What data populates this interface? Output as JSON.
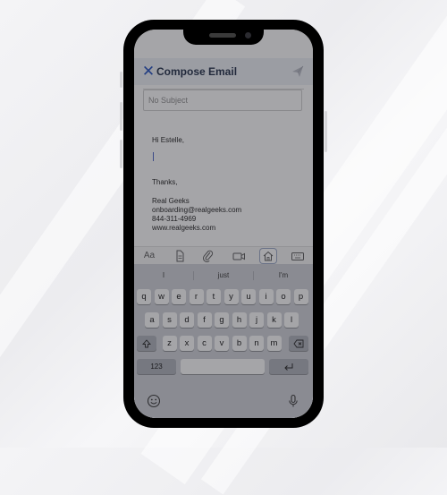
{
  "header": {
    "title": "Compose Email",
    "close_icon": "close-icon",
    "send_icon": "paper-plane-icon"
  },
  "subject": {
    "placeholder": "No Subject",
    "value": ""
  },
  "body": {
    "greeting": "Hi Estelle,",
    "closing": "Thanks,",
    "signature": [
      "Real Geeks",
      "onboarding@realgeeks.com",
      "844-311-4969",
      "www.realgeeks.com"
    ]
  },
  "toolbar": {
    "format_label": "Aa",
    "items": [
      "text-format-icon",
      "document-icon",
      "paperclip-icon",
      "video-icon",
      "home-icon",
      "keyboard-icon"
    ],
    "active": "home-icon"
  },
  "keyboard": {
    "suggestions": [
      "I",
      "just",
      "I'm"
    ],
    "row1": [
      "q",
      "w",
      "e",
      "r",
      "t",
      "y",
      "u",
      "i",
      "o",
      "p"
    ],
    "row2": [
      "a",
      "s",
      "d",
      "f",
      "g",
      "h",
      "j",
      "k",
      "l"
    ],
    "row3": [
      "z",
      "x",
      "c",
      "v",
      "b",
      "n",
      "m"
    ],
    "numbers_label": "123",
    "shift_icon": "shift-icon",
    "delete_icon": "backspace-icon",
    "return_icon": "return-icon",
    "emoji_icon": "emoji-icon",
    "mic_icon": "microphone-icon"
  },
  "colors": {
    "accent": "#1f4fbf",
    "header_bg": "#eef1f7",
    "keyboard_bg": "#d1d3d9"
  }
}
